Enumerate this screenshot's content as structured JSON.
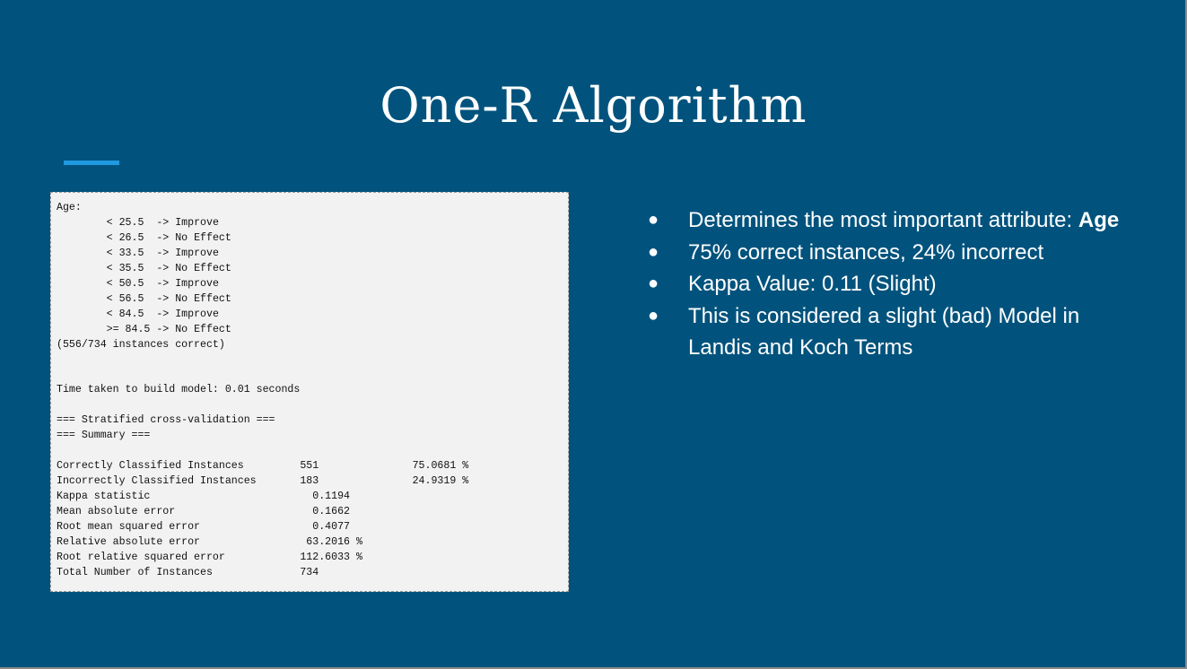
{
  "slide": {
    "title": "One-R Algorithm",
    "colors": {
      "background": "#01537d",
      "accent": "#1f9ae0",
      "text": "#ffffff",
      "panel": "#f2f2f2"
    }
  },
  "weka_output": {
    "lines": [
      "Age:",
      "\t< 25.5\t-> Improve",
      "\t< 26.5\t-> No Effect",
      "\t< 33.5\t-> Improve",
      "\t< 35.5\t-> No Effect",
      "\t< 50.5\t-> Improve",
      "\t< 56.5\t-> No Effect",
      "\t< 84.5\t-> Improve",
      "\t>= 84.5\t-> No Effect",
      "(556/734 instances correct)",
      "",
      "",
      "Time taken to build model: 0.01 seconds",
      "",
      "=== Stratified cross-validation ===",
      "=== Summary ===",
      "",
      "Correctly Classified Instances         551               75.0681 %",
      "Incorrectly Classified Instances       183               24.9319 %",
      "Kappa statistic                          0.1194",
      "Mean absolute error                      0.1662",
      "Root mean squared error                  0.4077",
      "Relative absolute error                 63.2016 %",
      "Root relative squared error            112.6033 %",
      "Total Number of Instances              734"
    ]
  },
  "bullets": [
    {
      "marker": "●",
      "text": "Determines the most important attribute: ",
      "bold": "Age"
    },
    {
      "marker": "●",
      "text": "75% correct instances, 24% incorrect",
      "bold": ""
    },
    {
      "marker": "●",
      "text": "Kappa Value: 0.11 (Slight)",
      "bold": ""
    },
    {
      "marker": "●",
      "text": "This is considered a slight (bad) Model in Landis and Koch Terms",
      "bold": ""
    }
  ]
}
